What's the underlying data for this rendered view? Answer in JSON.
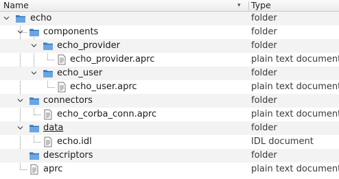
{
  "header": {
    "name_label": "Name",
    "type_label": "Type"
  },
  "rows": [
    {
      "name": "echo",
      "type": "folder"
    },
    {
      "name": "components",
      "type": "folder"
    },
    {
      "name": "echo_provider",
      "type": "folder"
    },
    {
      "name": "echo_provider.aprc",
      "type": "plain text document"
    },
    {
      "name": "echo_user",
      "type": "folder"
    },
    {
      "name": "echo_user.aprc",
      "type": "plain text document"
    },
    {
      "name": "connectors",
      "type": "folder"
    },
    {
      "name": "echo_corba_conn.aprc",
      "type": "plain text document"
    },
    {
      "name": "data",
      "type": "folder"
    },
    {
      "name": "echo.idl",
      "type": "IDL document"
    },
    {
      "name": "descriptors",
      "type": "folder"
    },
    {
      "name": "aprc",
      "type": "plain text document"
    }
  ],
  "icons": {
    "folder": "folder-icon",
    "file": "text-document-icon",
    "expander": "chevron-down-icon",
    "sort": "sort-descending-icon"
  },
  "colors": {
    "folder_blue": "#4a8ad0",
    "row_alt": "#f3f3f3",
    "tree_line": "#8a8a8a"
  }
}
